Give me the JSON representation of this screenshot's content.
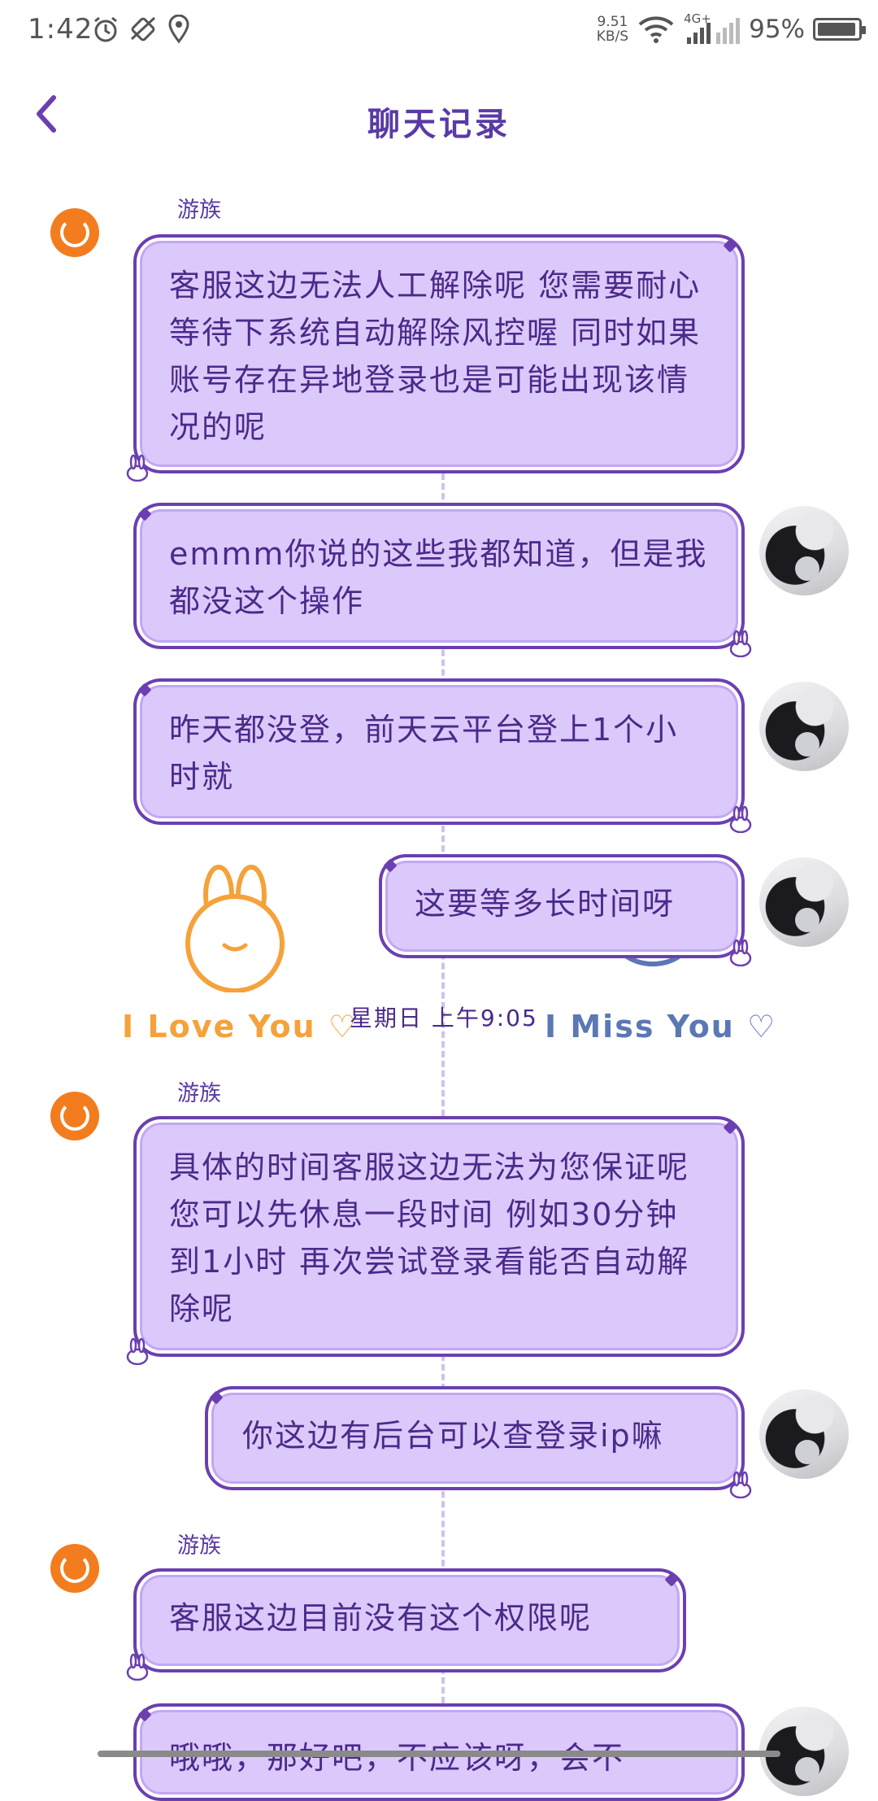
{
  "status_bar": {
    "time": "1:42",
    "net_speed_value": "9.51",
    "net_speed_unit": "KB/S",
    "signal_label": "4G+",
    "battery_percent": "95%",
    "battery_level": 0.95
  },
  "nav": {
    "title": "聊天记录",
    "back_icon": "chevron-left-icon"
  },
  "messages": [
    {
      "from": "agent",
      "sender": "游族",
      "text": "客服这边无法人工解除呢 您需要耐心等待下系统自动解除风控喔 同时如果账号存在异地登录也是可能出现该情况的呢"
    },
    {
      "from": "user",
      "text": "emmm你说的这些我都知道，但是我都没这个操作"
    },
    {
      "from": "user",
      "text": "昨天都没登，前天云平台登上1个小时就"
    },
    {
      "from": "user",
      "text": "这要等多长时间呀"
    },
    {
      "from": "agent",
      "sender": "游族",
      "text": "具体的时间客服这边无法为您保证呢 您可以先休息一段时间 例如30分钟到1小时 再次尝试登录看能否自动解除呢"
    },
    {
      "from": "user",
      "text": "你这边有后台可以查登录ip嘛"
    },
    {
      "from": "agent",
      "sender": "游族",
      "text": "客服这边目前没有这个权限呢"
    },
    {
      "from": "user",
      "text": "哦哦，那好吧，不应该呀，会不"
    }
  ],
  "timestamp_row": {
    "timestamp": "星期日 上午9:05",
    "left_sticker": "I Love You ♡",
    "right_sticker": "I Miss You ♡"
  },
  "colors": {
    "bubble_fill": "#dcc9fb",
    "bubble_border": "#6b3fb0",
    "title": "#5a3aa5",
    "agent_avatar": "#f37c1e"
  }
}
